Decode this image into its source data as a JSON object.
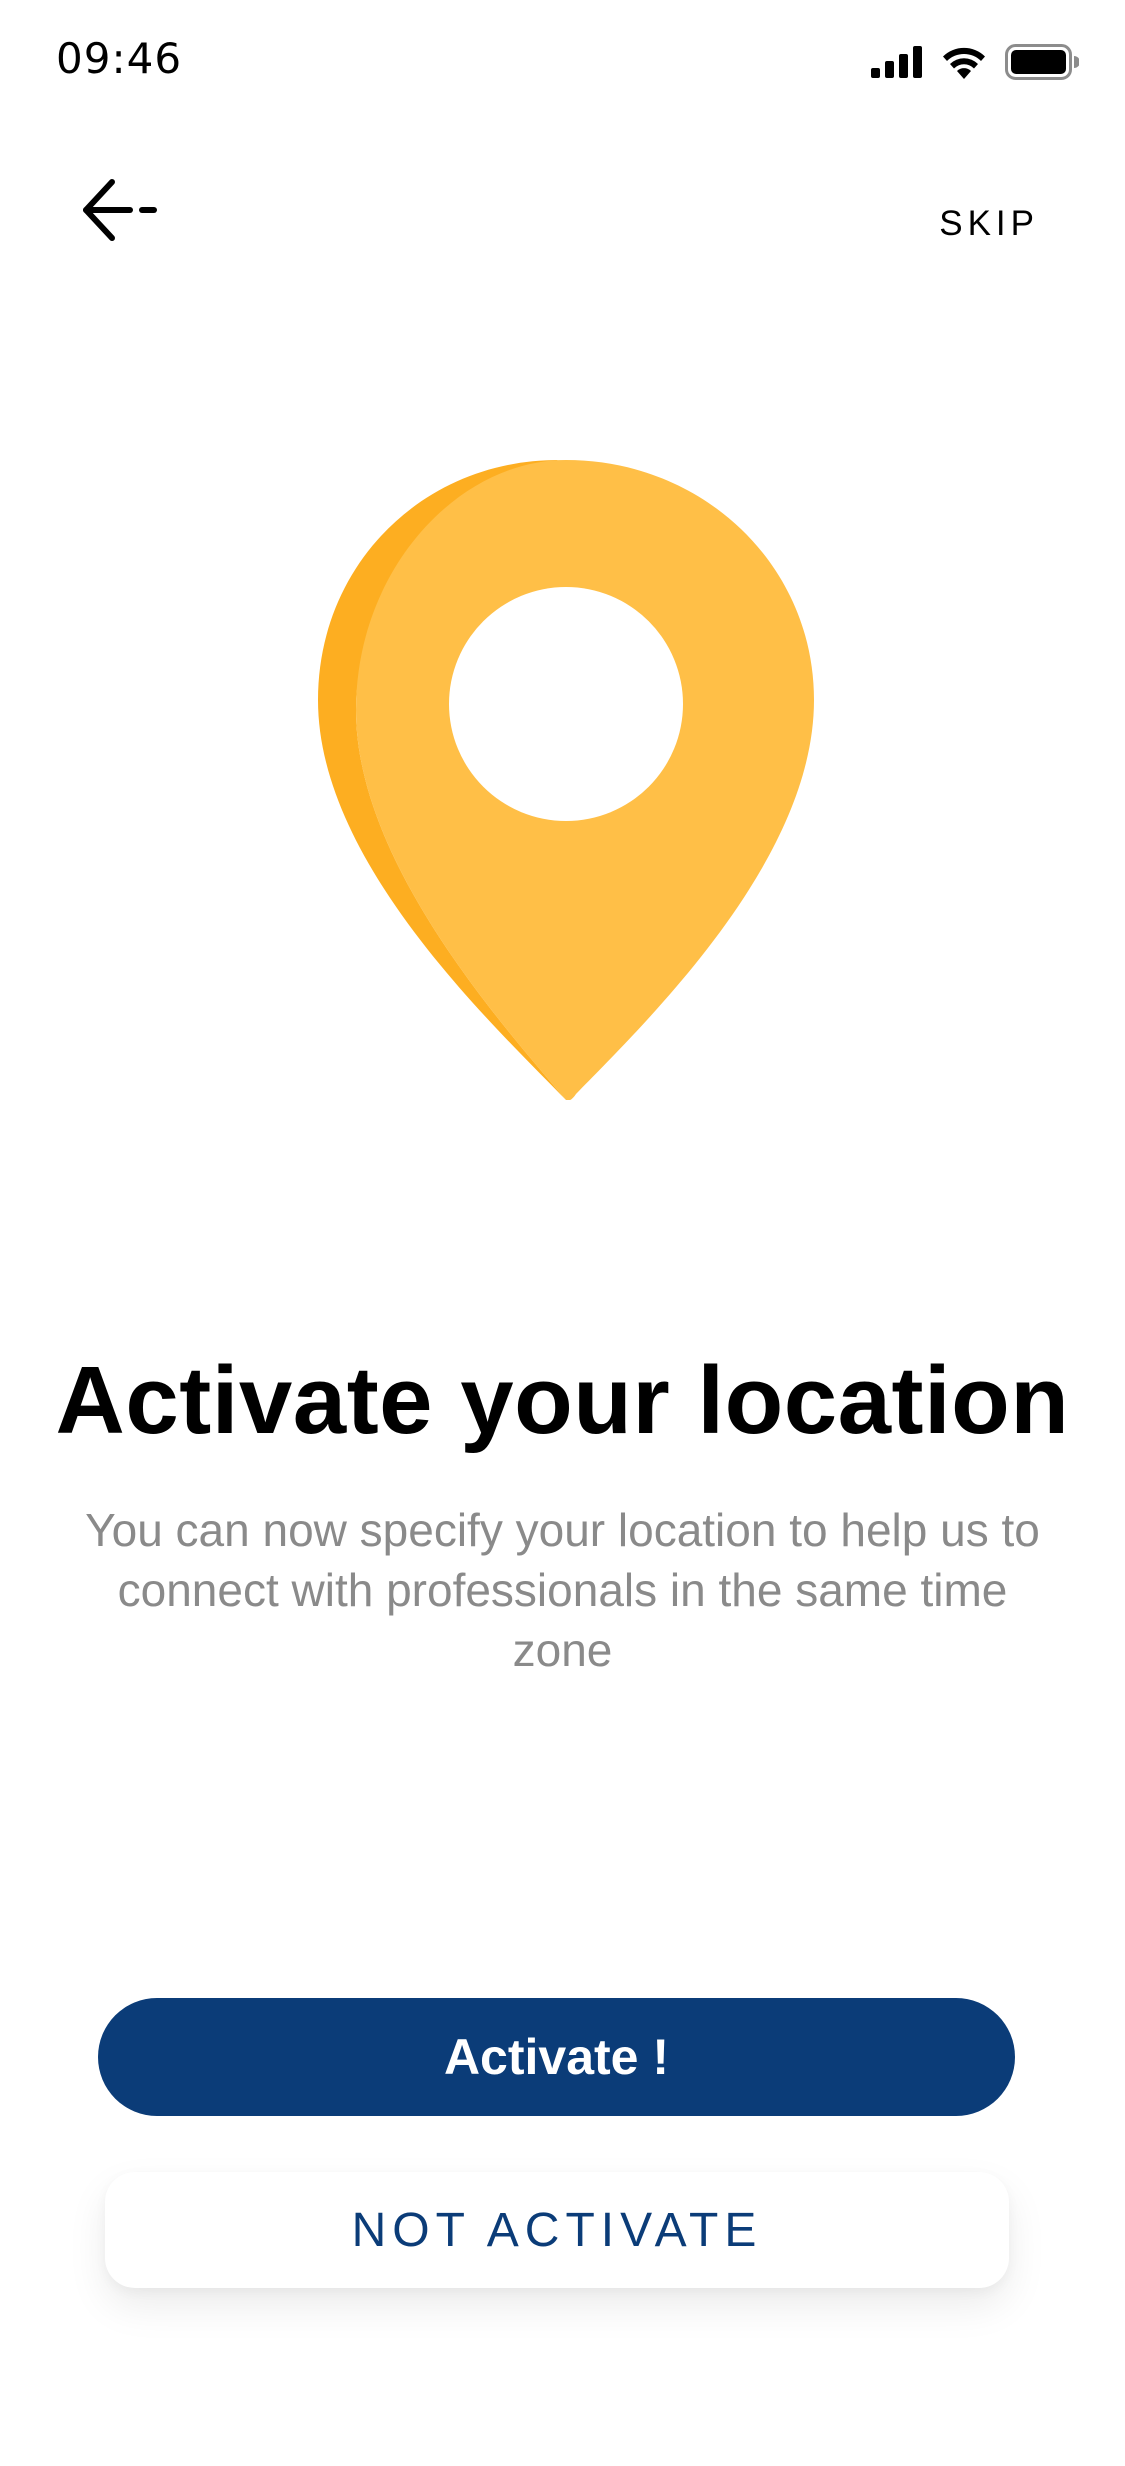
{
  "status_bar": {
    "time": "09:46",
    "icons": [
      "cellular-signal-icon",
      "wifi-icon",
      "battery-icon"
    ]
  },
  "nav": {
    "back_icon": "back-arrow-icon",
    "skip_label": "SKIP"
  },
  "illustration": {
    "icon": "location-pin-icon",
    "pin_color": "#FFBF47",
    "pin_shade_color": "#FDAE21"
  },
  "content": {
    "title": "Activate your location",
    "description": "You can now specify your location to help us to connect with professionals in the same time zone"
  },
  "actions": {
    "activate_label": "Activate !",
    "not_activate_label": "NOT ACTIVATE",
    "primary_color": "#0B3C78"
  }
}
